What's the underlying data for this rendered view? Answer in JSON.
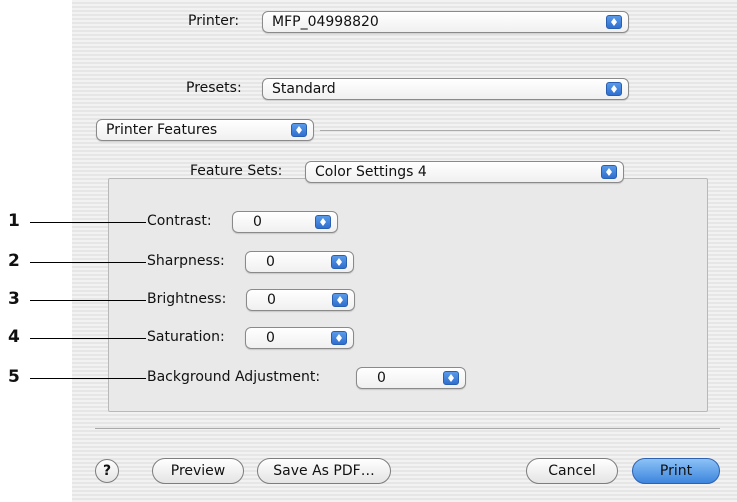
{
  "printer": {
    "label": "Printer:",
    "value": "MFP_04998820"
  },
  "presets": {
    "label": "Presets:",
    "value": "Standard"
  },
  "panel": {
    "value": "Printer Features"
  },
  "feature_sets": {
    "label": "Feature Sets:",
    "value": "Color Settings 4"
  },
  "settings": [
    {
      "callout": "1",
      "label": "Contrast:",
      "value": "0"
    },
    {
      "callout": "2",
      "label": "Sharpness:",
      "value": "0"
    },
    {
      "callout": "3",
      "label": "Brightness:",
      "value": "0"
    },
    {
      "callout": "4",
      "label": "Saturation:",
      "value": "0"
    },
    {
      "callout": "5",
      "label": "Background Adjustment:",
      "value": "0"
    }
  ],
  "buttons": {
    "help": "?",
    "preview": "Preview",
    "save_pdf": "Save As PDF…",
    "cancel": "Cancel",
    "print": "Print"
  },
  "colors": {
    "accent": "#3d85de",
    "dialog_bg": "#ededed"
  }
}
